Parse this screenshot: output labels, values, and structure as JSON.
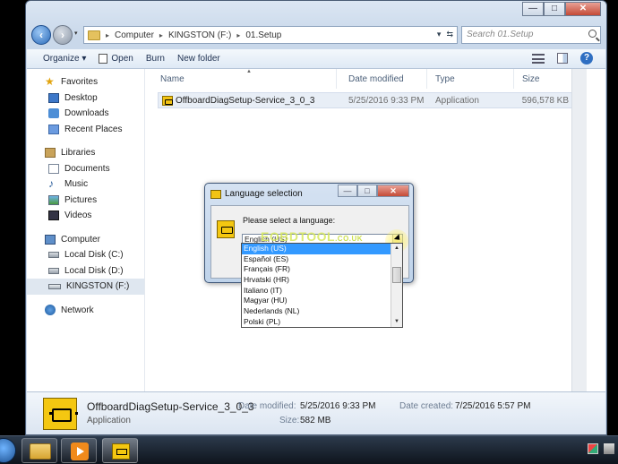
{
  "window": {
    "caption_buttons": {
      "minimize": "—",
      "maximize": "□",
      "close": "✕"
    }
  },
  "address": {
    "path": [
      "Computer",
      "KINGSTON (F:)",
      "01.Setup"
    ],
    "search_placeholder": "Search 01.Setup"
  },
  "toolbar": {
    "organize": "Organize ▾",
    "open": "Open",
    "burn": "Burn",
    "new_folder": "New folder",
    "help": "?"
  },
  "sidebar": {
    "favorites": "Favorites",
    "favorites_items": [
      "Desktop",
      "Downloads",
      "Recent Places"
    ],
    "libraries": "Libraries",
    "libraries_items": [
      "Documents",
      "Music",
      "Pictures",
      "Videos"
    ],
    "computer": "Computer",
    "computer_items": [
      "Local Disk (C:)",
      "Local Disk (D:)",
      "KINGSTON (F:)"
    ],
    "network": "Network"
  },
  "columns": {
    "name": "Name",
    "date": "Date modified",
    "type": "Type",
    "size": "Size"
  },
  "files": [
    {
      "name": "OffboardDiagSetup-Service_3_0_3",
      "date": "5/25/2016 9:33 PM",
      "type": "Application",
      "size": "596,578 KB"
    }
  ],
  "details": {
    "name": "OffboardDiagSetup-Service_3_0_3",
    "type": "Application",
    "date_modified_label": "Date modified:",
    "date_modified": "5/25/2016 9:33 PM",
    "date_created_label": "Date created:",
    "date_created": "7/25/2016 5:57 PM",
    "size_label": "Size:",
    "size": "582 MB"
  },
  "dialog": {
    "title": "Language selection",
    "prompt": "Please select a language:",
    "selected": "English (US)",
    "options": [
      "English (US)",
      "Español (ES)",
      "Français (FR)",
      "Hrvatski (HR)",
      "Italiano (IT)",
      "Magyar (HU)",
      "Nederlands (NL)",
      "Polski (PL)"
    ],
    "watermark": "EOBDTOOL",
    "watermark_suffix": ".CO.UK"
  },
  "icons": {
    "app": "obd-connector-icon",
    "explorer": "folder-icon",
    "media": "media-player-icon"
  },
  "colors": {
    "selection": "#3399ff",
    "app_icon": "#f4c711"
  }
}
